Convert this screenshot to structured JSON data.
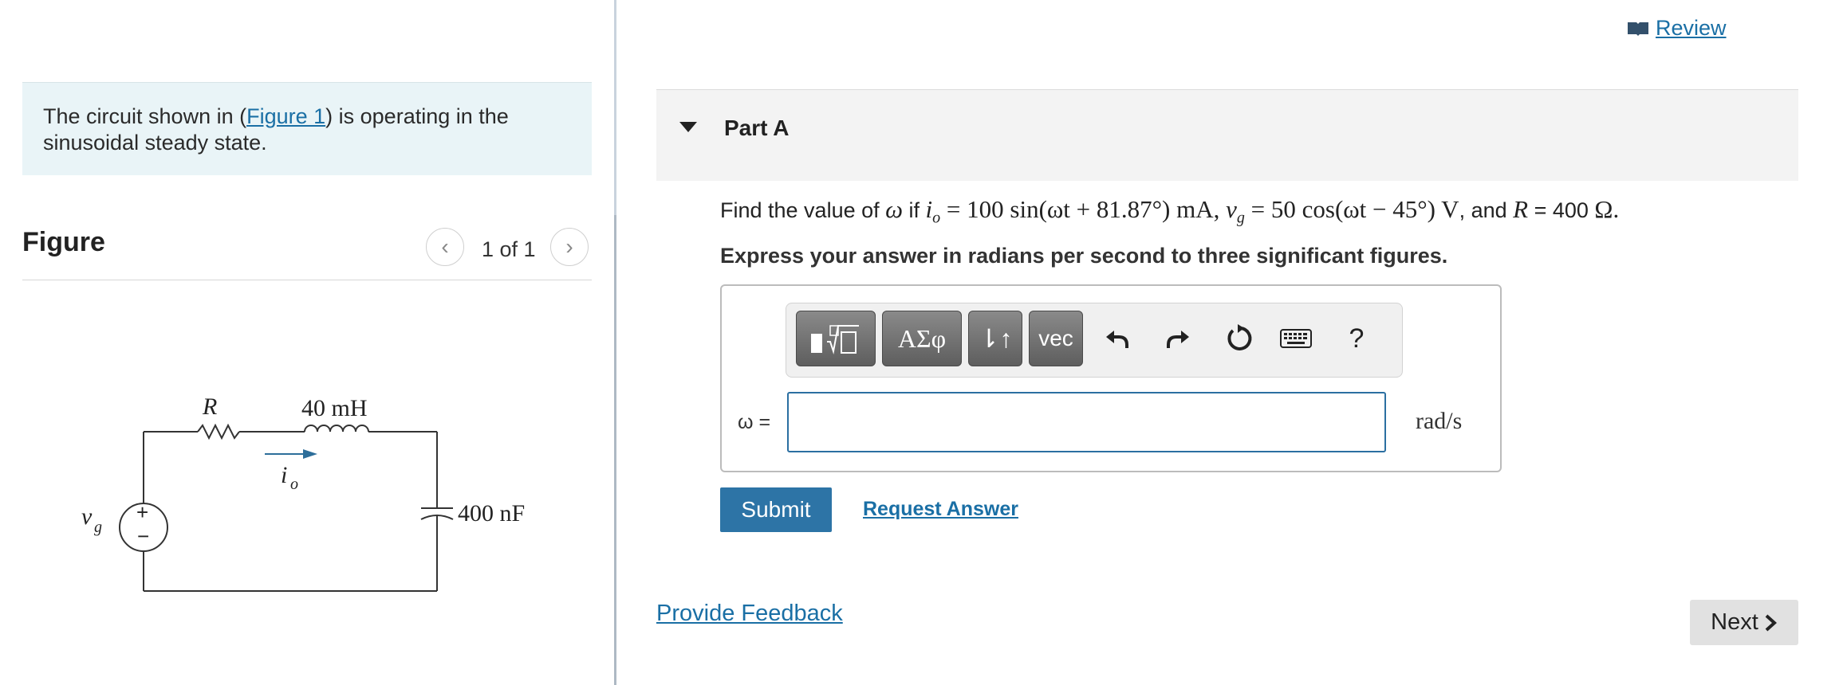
{
  "left": {
    "intro_prefix": "The circuit shown in (",
    "intro_link": "Figure 1",
    "intro_suffix": ") is operating in the sinusoidal steady state.",
    "figure_title": "Figure",
    "figure_counter": "1 of 1",
    "circuit": {
      "resistor_label": "R",
      "inductor_label": "40 mH",
      "current_label": "i",
      "current_sub": "o",
      "capacitor_label": "400 nF",
      "source_label": "v",
      "source_sub": "g",
      "source_plus": "+",
      "source_minus": "−"
    }
  },
  "header": {
    "review_label": "Review"
  },
  "part": {
    "title": "Part A",
    "question": {
      "t1": "Find the value of ",
      "m1": "ω",
      "t2": " if ",
      "m2": "i",
      "m2sub": "o",
      "m3": " = 100 sin(ωt + 81.87°) mA, ",
      "m4": "v",
      "m4sub": "g",
      "m5": " = 50 cos(ωt − 45°) V",
      "t3": ", and ",
      "m6": "R",
      "t4": " = 400 ",
      "m7": "Ω."
    },
    "instruction": "Express your answer in radians per second to three significant figures."
  },
  "toolbar": {
    "greek_label": "ΑΣφ",
    "arrows_label": "⇂↑",
    "vec_label": "vec",
    "help_label": "?"
  },
  "answer": {
    "variable_label": "ω =",
    "value": "",
    "unit": "rad/s"
  },
  "actions": {
    "submit_label": "Submit",
    "request_answer_label": "Request Answer",
    "provide_feedback_label": "Provide Feedback",
    "next_label": "Next"
  },
  "colors": {
    "link": "#1a6fa5",
    "submit_bg": "#2d74a6",
    "intro_bg": "#e9f4f7",
    "part_header_bg": "#f3f3f3",
    "input_border": "#2b6fa1"
  }
}
